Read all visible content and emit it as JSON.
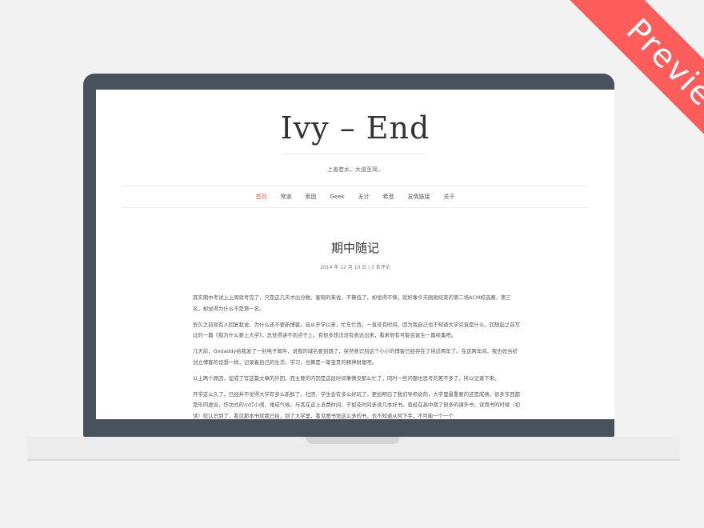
{
  "site": {
    "title": "Ivy – End",
    "tagline": "上善若水，大道至简。"
  },
  "nav": {
    "items": [
      "首页",
      "常道",
      "索因",
      "Geek",
      "无计",
      "希音",
      "友情链接",
      "关于"
    ],
    "active_index": 0,
    "active_color": "#e4593c"
  },
  "post": {
    "title": "期中随记",
    "meta": "2014 年 12 月 10 日 | 3 条评论",
    "paragraphs": [
      "其实期中考试上上周就考完了，只是这几天才出分数。客观的来说，不算低了，却觉得不够。就好像今天刚刚结束的第二场ACM校选赛，第三名，却觉得为什么不是第一名。",
      "很久之前就有人回复我说，为什么还不更新博客。自从开学以来，忙东忙西，一直没有时间，因为我自己也不知道大学究竟是什么，回想起之前写过的一篇《我为什么要上大学》，总觉得讲不到点子上，有很多想法没有表达出来，看来很有可能会诞生一篇续集吧。",
      "几天前，Godaddy给我发了一封电子邮件，说我的域名要到期了，突然意识到这个小小的博客已经存在了将近两年了。在这两年间，我也如当初创立博客的设想一样，记录着自己的生活，学习，也算是一笔宝贵的精神财富吧。",
      "以上两个原因，促成了写这篇文章的外因，而主要的内因是这段时间事情没那么忙了，同时一些问题也思考的差不多了，所以记录下来。",
      "开学这么久了，已经并不觉得大学有多么新鲜了，社团、学生会有多么好玩了。更加明白了我们导师说的，大学里最重要的还是成绩。很多东西都是形同虚设，作坊式的小打小闹，难成气候。与其在这上浪费时间，不如花时间多读几本好书。曾经在高中期了很多的课外书，读而书的时候（初读）就认识到了，看见那本书就我已经，到了大学里，看见图书馆这么多的书，也不知道从何下手，不可能一个一个"
    ]
  },
  "ribbon": {
    "label": "Preview",
    "color": "#ff5c5c"
  },
  "colors": {
    "laptop_frame": "#49515c",
    "page_background": "#f2f2f2"
  }
}
